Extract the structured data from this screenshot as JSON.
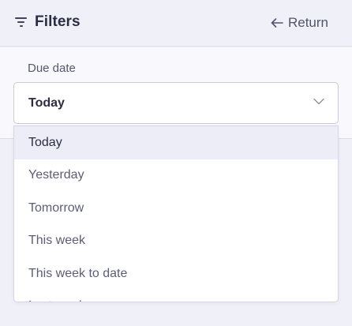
{
  "header": {
    "title": "Filters",
    "filter_icon": "filter-lines-icon",
    "return_label": "Return",
    "return_icon": "arrow-left-icon"
  },
  "filter": {
    "label": "Due date",
    "selected_value": "Today",
    "chevron_icon": "chevron-down-icon"
  },
  "dropdown": {
    "options": [
      {
        "label": "Today",
        "selected": true
      },
      {
        "label": "Yesterday",
        "selected": false
      },
      {
        "label": "Tomorrow",
        "selected": false
      },
      {
        "label": "This week",
        "selected": false
      },
      {
        "label": "This week to date",
        "selected": false
      },
      {
        "label": "Last week",
        "selected": false
      }
    ]
  },
  "colors": {
    "background": "#f0f0f8",
    "panel": "#f9f9fd",
    "selected_option_bg": "#ededf7",
    "text_primary": "#2b2d42",
    "text_secondary": "#5b5e76"
  }
}
